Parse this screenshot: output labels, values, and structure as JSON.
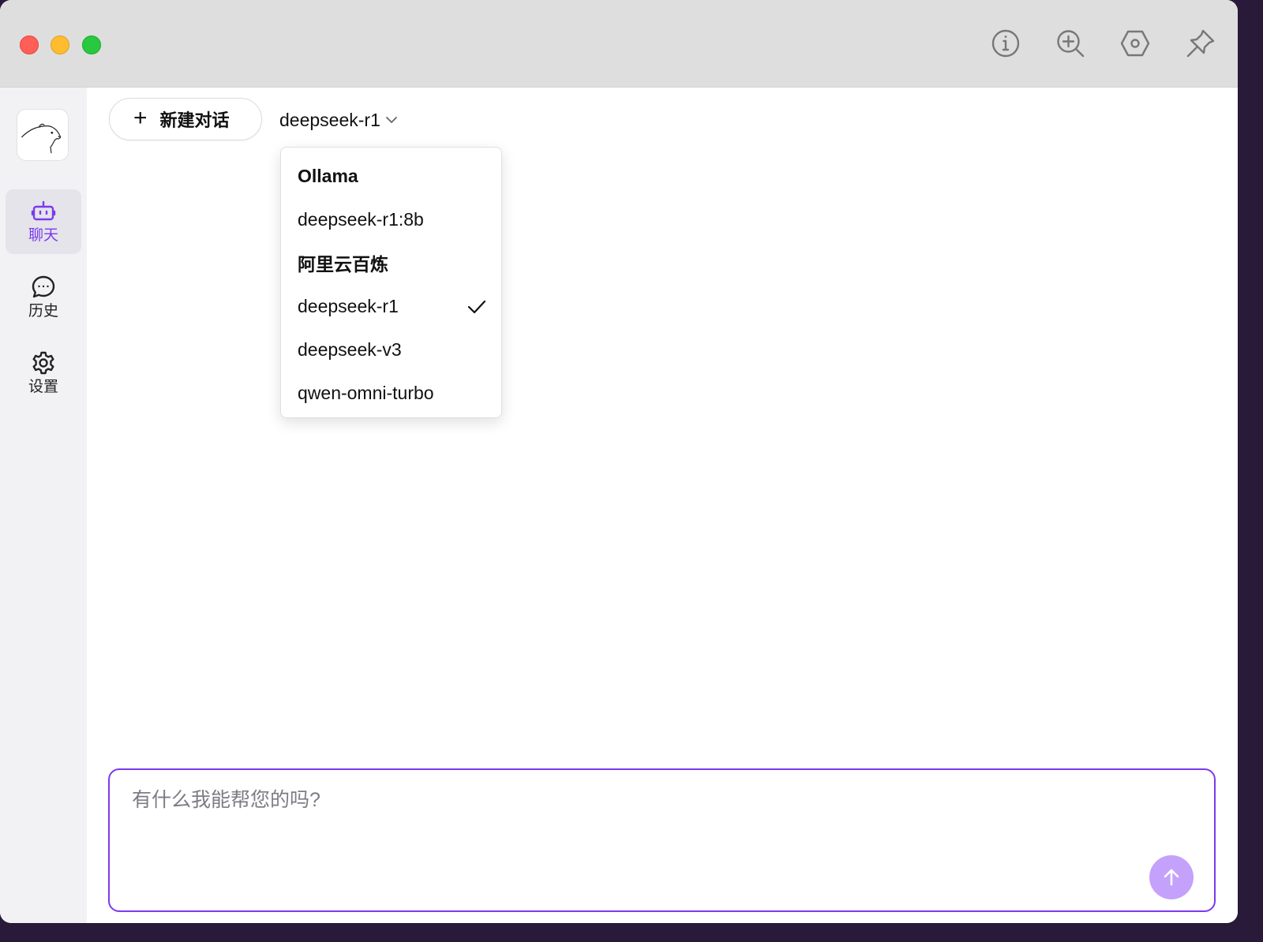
{
  "window": {
    "traffic_lights": [
      "close",
      "minimize",
      "maximize"
    ],
    "toolbar_icons": [
      "info-icon",
      "zoom-in-icon",
      "hexagon-settings-icon",
      "pin-icon"
    ]
  },
  "sidebar": {
    "logo": "bear-logo",
    "items": [
      {
        "label": "聊天",
        "icon": "robot-icon",
        "active": true
      },
      {
        "label": "历史",
        "icon": "chat-bubble-icon",
        "active": false
      },
      {
        "label": "设置",
        "icon": "gear-icon",
        "active": false
      }
    ]
  },
  "header": {
    "new_chat_label": "新建对话",
    "selected_model": "deepseek-r1"
  },
  "model_dropdown": {
    "groups": [
      {
        "name": "Ollama",
        "options": [
          "deepseek-r1:8b"
        ]
      },
      {
        "name": "阿里云百炼",
        "options": [
          "deepseek-r1",
          "deepseek-v3",
          "qwen-omni-turbo"
        ]
      }
    ],
    "selected": "deepseek-r1"
  },
  "composer": {
    "placeholder": "有什么我能帮您的吗?"
  },
  "colors": {
    "accent": "#7c3aed",
    "send_button": "#c4a2fb",
    "sidebar_bg": "#f2f2f5",
    "titlebar_bg": "#dedede"
  }
}
